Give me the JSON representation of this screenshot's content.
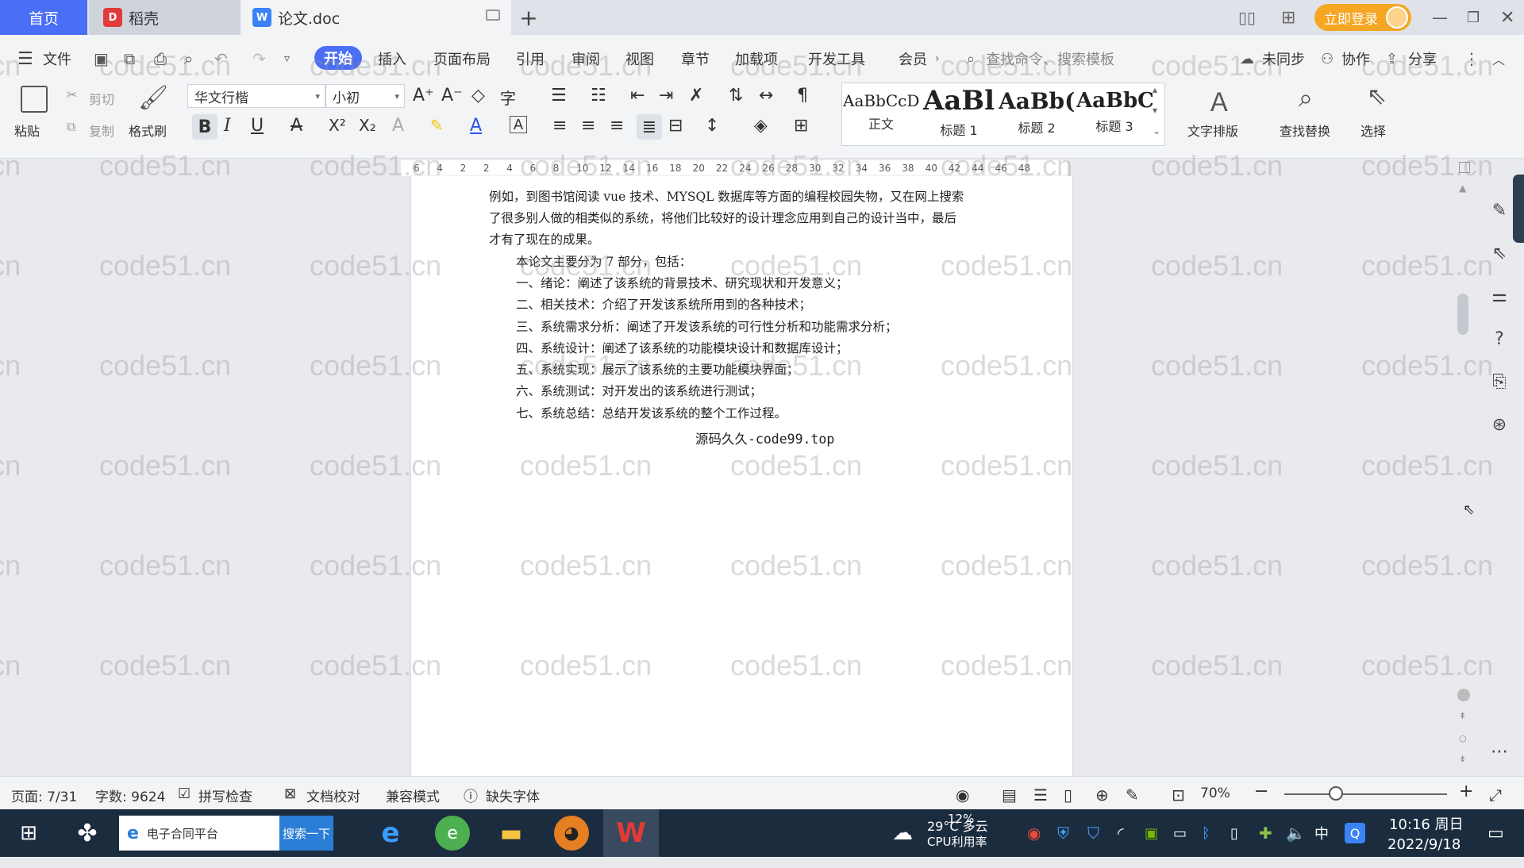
{
  "titlebar": {
    "tabs": [
      {
        "label": "首页"
      },
      {
        "label": "稻壳"
      },
      {
        "label": "论文.doc"
      }
    ],
    "login_label": "立即登录"
  },
  "menubar": {
    "file_label": "文件",
    "items": [
      "开始",
      "插入",
      "页面布局",
      "引用",
      "审阅",
      "视图",
      "章节",
      "加载项",
      "开发工具",
      "会员"
    ],
    "search_cmd": "查找命令、搜索模板",
    "sync_label": "未同步",
    "collab_label": "协作",
    "share_label": "分享"
  },
  "ribbon": {
    "paste_label": "粘贴",
    "cut_label": "剪切",
    "copy_label": "复制",
    "format_painter_label": "格式刷",
    "font_name": "华文行楷",
    "font_size": "小初",
    "styles": [
      {
        "preview": "AaBbCcDd",
        "label": "正文"
      },
      {
        "preview": "AaBl",
        "label": "标题 1"
      },
      {
        "preview": "AaBb(",
        "label": "标题 2"
      },
      {
        "preview": "AaBbC",
        "label": "标题 3"
      }
    ],
    "text_layout_label": "文字排版",
    "find_replace_label": "查找替换",
    "select_label": "选择"
  },
  "ruler": [
    "6",
    "4",
    "2",
    "2",
    "4",
    "6",
    "8",
    "10",
    "12",
    "14",
    "16",
    "18",
    "20",
    "22",
    "24",
    "26",
    "28",
    "30",
    "32",
    "34",
    "36",
    "38",
    "40",
    "42",
    "44",
    "46",
    "48"
  ],
  "document": {
    "lines": [
      "例如，到图书馆阅读 vue 技术、MYSQL 数据库等方面的编程校园失物，又在网上搜索",
      "了很多别人做的相类似的系统，将他们比较好的设计理念应用到自己的设计当中，最后",
      "才有了现在的成果。",
      "本论文主要分为 7 部分，包括：",
      "一、绪论：阐述了该系统的背景技术、研究现状和开发意义；",
      "二、相关技术：介绍了开发该系统所用到的各种技术；",
      "三、系统需求分析：阐述了开发该系统的可行性分析和功能需求分析；",
      "四、系统设计：阐述了该系统的功能模块设计和数据库设计；",
      "五、系统实现：展示了该系统的主要功能模块界面；",
      "六、系统测试：对开发出的该系统进行测试；",
      "七、系统总结：总结开发该系统的整个工作过程。"
    ],
    "source_line": "源码久久-code99.top"
  },
  "statusbar": {
    "page": "页面: 7/31",
    "word_count": "字数: 9624",
    "spell_check": "拼写检查",
    "doc_proof": "文档校对",
    "compat_mode": "兼容模式",
    "missing_font": "缺失字体",
    "zoom": "70%",
    "zoom_level_fraction": 0.3
  },
  "taskbar": {
    "search_text": "电子合同平台",
    "search_btn": "搜索一下",
    "weather_temp": "29°C 多云",
    "cpu_pct": "12%",
    "cpu_label": "CPU利用率",
    "ime": "中",
    "time": "10:16 周日",
    "date": "2022/9/18"
  },
  "watermark_text": "code51.cn",
  "colors": {
    "accent": "#4a6ef5",
    "login": "#f5a623",
    "taskbar": "#1b2c3f"
  }
}
